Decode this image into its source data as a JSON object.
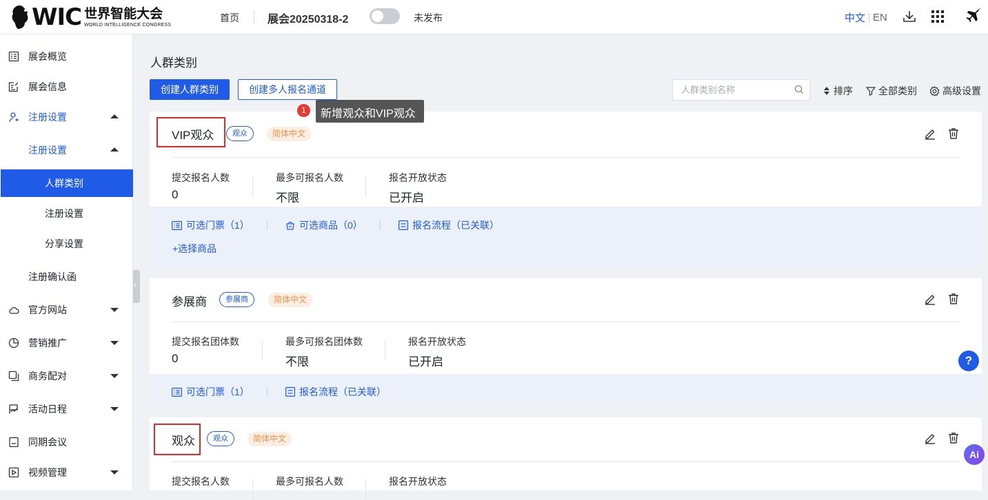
{
  "header": {
    "logo_text": "WIC",
    "logo_cn": "世界智能大会",
    "logo_en": "WORLD INTELLIGENCE CONGRESS",
    "home": "首页",
    "expo_name": "展会20250318-2",
    "publish_status": "未发布",
    "lang_zh": "中文",
    "lang_en": "EN"
  },
  "sidebar": {
    "items": [
      {
        "label": "展会概览"
      },
      {
        "label": "展会信息"
      },
      {
        "label": "注册设置"
      },
      {
        "label": "注册设置"
      },
      {
        "label": "人群类别"
      },
      {
        "label": "注册设置"
      },
      {
        "label": "分享设置"
      },
      {
        "label": "注册确认函"
      },
      {
        "label": "官方网站"
      },
      {
        "label": "营销推广"
      },
      {
        "label": "商务配对"
      },
      {
        "label": "活动日程"
      },
      {
        "label": "同期会议"
      },
      {
        "label": "视频管理"
      }
    ]
  },
  "main": {
    "title": "人群类别",
    "create_button": "创建人群类别",
    "create_multi_button": "创建多人报名通道",
    "search_placeholder": "人群类别名称",
    "sort": "排序",
    "all_categories": "全部类别",
    "advanced": "高级设置",
    "tooltip": "新增观众和VIP观众",
    "tooltip_badge": "1"
  },
  "cards": [
    {
      "name": "VIP观众",
      "type_tag": "观众",
      "lang_tag": "简体中文",
      "stats": [
        {
          "label": "提交报名人数",
          "value": "0"
        },
        {
          "label": "最多可报名人数",
          "value": "不限"
        },
        {
          "label": "报名开放状态",
          "value": "已开启"
        }
      ],
      "links": [
        "可选门票（1）",
        "可选商品（0）",
        "报名流程（已关联）"
      ],
      "add_product": "+选择商品"
    },
    {
      "name": "参展商",
      "type_tag": "参展商",
      "lang_tag": "简体中文",
      "stats": [
        {
          "label": "提交报名团体数",
          "value": "0"
        },
        {
          "label": "最多可报名团体数",
          "value": "不限"
        },
        {
          "label": "报名开放状态",
          "value": "已开启"
        }
      ],
      "links": [
        "可选门票（1）",
        "报名流程（已关联）"
      ]
    },
    {
      "name": "观众",
      "type_tag": "观众",
      "lang_tag": "简体中文",
      "stats": [
        {
          "label": "提交报名人数"
        },
        {
          "label": "最多可报名人数"
        },
        {
          "label": "报名开放状态"
        }
      ]
    }
  ],
  "floating": {
    "help": "?",
    "ai": "Ai"
  }
}
